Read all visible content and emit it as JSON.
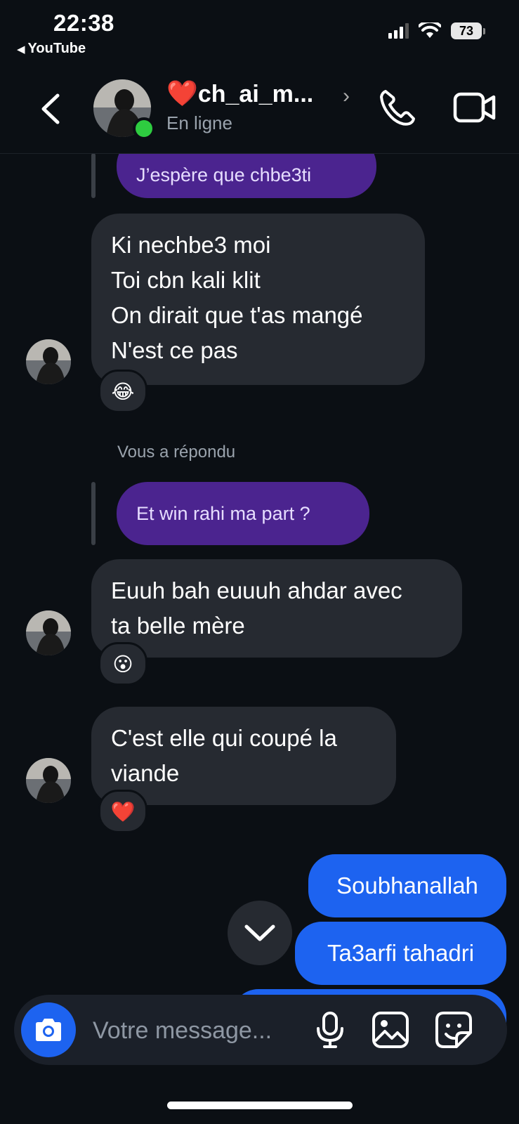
{
  "status_bar": {
    "time": "22:38",
    "back_app": "YouTube",
    "battery": "73"
  },
  "header": {
    "contact_heart": "❤️",
    "contact_name": "ch_ai_m...",
    "presence": "En ligne"
  },
  "messages": [
    {
      "type": "reply-quote",
      "text": "J’espère que chbe3ti"
    },
    {
      "type": "received",
      "lines": [
        "Ki nechbe3 moi",
        "Toi cbn kali klit",
        "On dirait que t'as mangé",
        "N'est ce pas"
      ],
      "reaction": "😂"
    },
    {
      "type": "reply-label",
      "text": "Vous a répondu"
    },
    {
      "type": "reply-quote",
      "text": "Et win rahi ma part ?"
    },
    {
      "type": "received",
      "lines": [
        "Euuh bah euuuh ahdar avec",
        "ta belle mère"
      ],
      "reaction": "😮"
    },
    {
      "type": "received",
      "lines": [
        "C'est elle qui coupé la",
        "viande"
      ],
      "reaction": "❤️"
    },
    {
      "type": "sent",
      "text": "Soubhanallah"
    },
    {
      "type": "sent",
      "text": "Ta3arfi tahadri"
    }
  ],
  "composer": {
    "placeholder": "Votre message..."
  },
  "colors": {
    "background": "#0b0f14",
    "received_bubble": "#262a31",
    "sent_bubble": "#1d63f0",
    "quoted_bubble": "#4b248f",
    "online": "#2ecc40"
  },
  "icons": [
    "back-chevron-icon",
    "phone-icon",
    "video-camera-icon",
    "camera-icon",
    "microphone-icon",
    "image-icon",
    "sticker-icon",
    "chevron-down-icon"
  ]
}
